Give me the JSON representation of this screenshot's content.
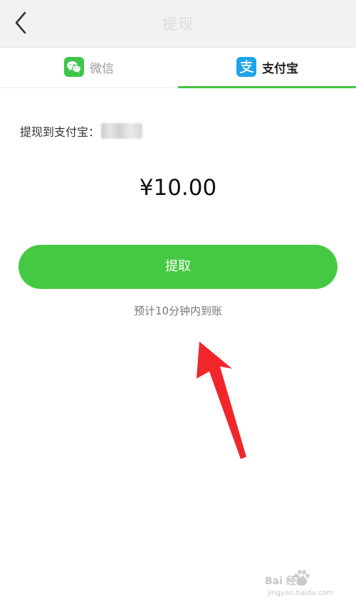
{
  "header": {
    "title": "提现"
  },
  "tabs": [
    {
      "label": "微信",
      "active": false,
      "icon": "wechat-icon"
    },
    {
      "label": "支付宝",
      "active": true,
      "icon": "alipay-icon"
    }
  ],
  "account": {
    "label": "提现到支付宝：",
    "visible_prefix": ""
  },
  "amount": {
    "currency_symbol": "¥",
    "value": "10.00",
    "display": "¥10.00"
  },
  "withdraw_button": {
    "label": "提取"
  },
  "eta_note": "预计10分钟内到账",
  "watermark": {
    "main": "Bai  经验",
    "sub": "jingyan.baidu.com"
  },
  "colors": {
    "primary_green": "#45c943",
    "tab_underline": "#45c443",
    "wechat_icon_bg": "#3fc64a",
    "alipay_icon_bg": "#1ea4ea",
    "annotation_arrow": "#f0262b"
  }
}
